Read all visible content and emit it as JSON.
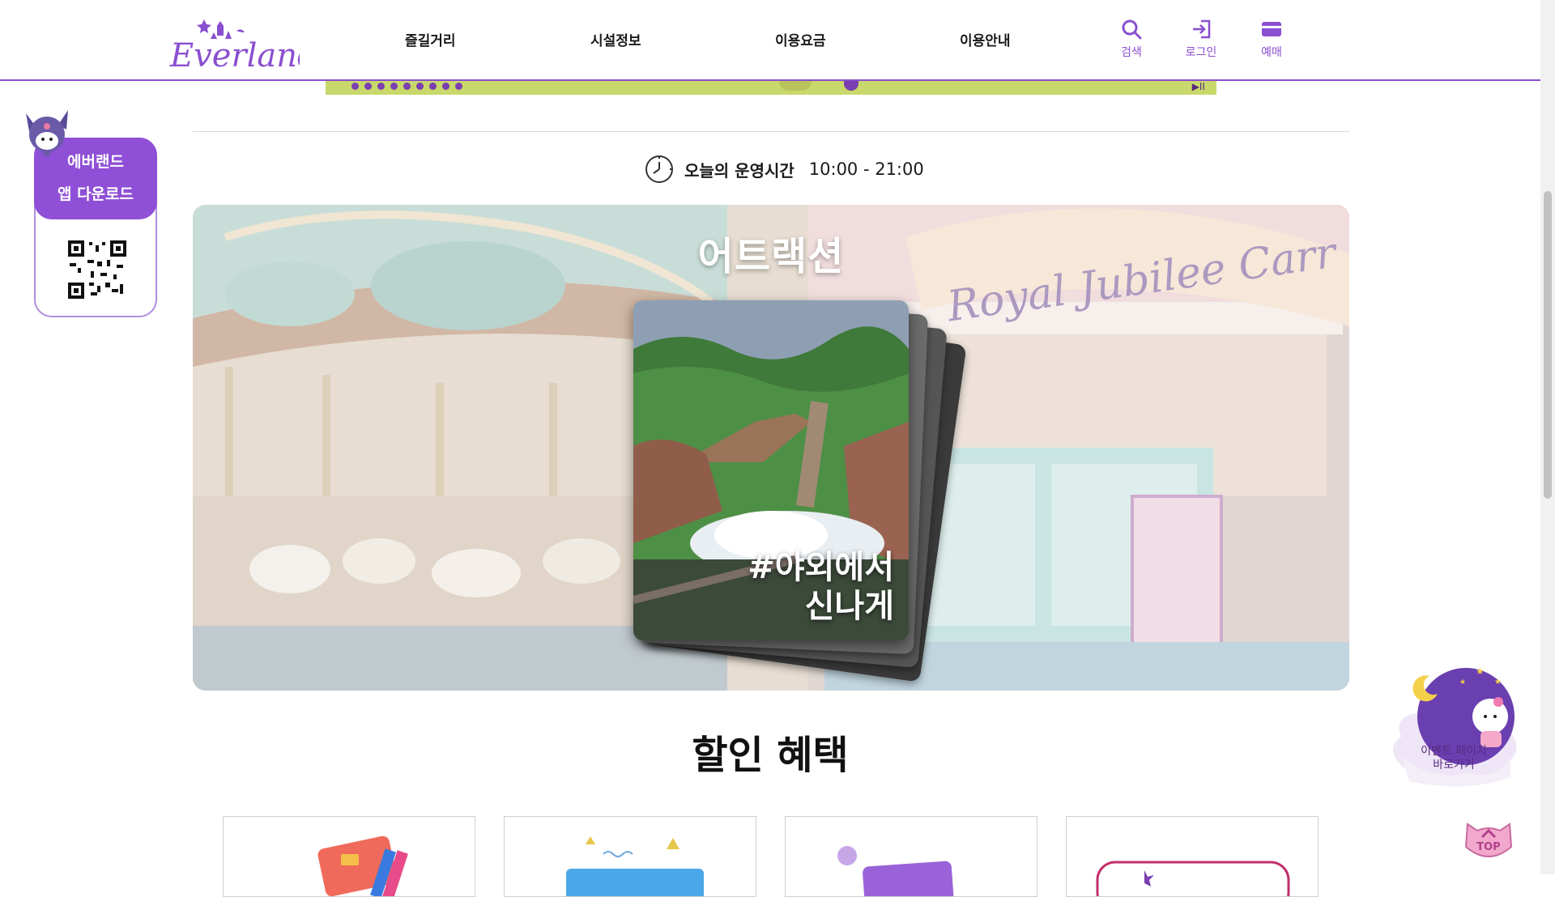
{
  "header": {
    "logo_text": "Everland",
    "nav": [
      "즐길거리",
      "시설정보",
      "이용요금",
      "이용안내"
    ],
    "utils": {
      "search": "검색",
      "login": "로그인",
      "ticket": "예매"
    }
  },
  "hours": {
    "label": "오늘의 운영시간",
    "value": "10:00 - 21:00"
  },
  "hero": {
    "title": "어트랙션",
    "card_caption_line1": "#야외에서",
    "card_caption_line2": "신나게",
    "bg_sign_text": "Royal Jubilee Carr"
  },
  "discount": {
    "title": "할인 혜택"
  },
  "app_download": {
    "line1": "에버랜드",
    "line2": "앱 다운로드"
  },
  "event_float": {
    "line1": "이벤트 페이지",
    "line2": "바로가기"
  },
  "top_button": {
    "label": "TOP"
  },
  "colors": {
    "brand_purple": "#8a4fd0",
    "app_purple": "#8f4fd6"
  }
}
